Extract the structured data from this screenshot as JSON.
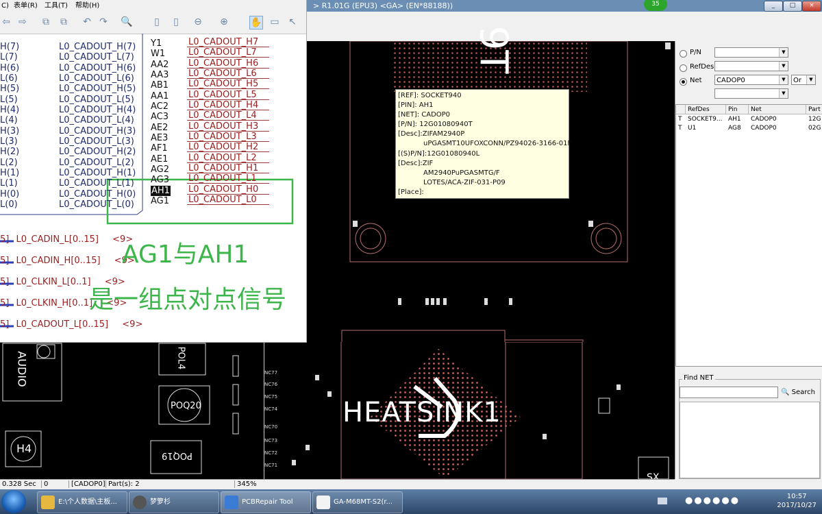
{
  "pcb_window": {
    "title": "> R1.01G (EPU3) <GA> (EN*88188))",
    "badge": "35",
    "controls": [
      "_",
      "□",
      "×"
    ]
  },
  "board_labels": {
    "top_partial": "9T",
    "audio": "AUDIO",
    "h4": "H4",
    "poq20": "POQ20",
    "poq19": "POQ19",
    "pol4": "POL4",
    "heatsink": "HEATSINK1",
    "sx": "SX",
    "nc_labels": [
      "NC77",
      "NC76",
      "NC75",
      "NC74",
      "NC73",
      "NC72",
      "NC71",
      "NC70"
    ]
  },
  "tooltip": {
    "ref": "[REF]:  SOCKET940",
    "pin": "[PIN]:  AH1",
    "net": "[NET]:  CADOP0",
    "pn": "[P/N]:  12G01080940T",
    "desc1": "[Desc]:ZIFAM2940P",
    "desc1b": "uPGASMT10UFOXCONN/PZ94026-3166-01F",
    "spn": "[(S)P/N]:12G01080940L",
    "desc2": "[Desc]:ZIF",
    "desc2b": "AM2940PuPGASMTG/F",
    "desc2c": "LOTES/ACA-ZIF-031-P09",
    "place": "[Place]:"
  },
  "search_panel": {
    "pn_label": "P/N",
    "refdes_label": "RefDes",
    "net_label": "Net",
    "net_value": "CADOP0",
    "logic_value": "Or",
    "selected": "Net"
  },
  "results": {
    "columns": [
      "RefDes",
      "Pin",
      "Net",
      "Part"
    ],
    "rows": [
      {
        "flag": "T",
        "refdes": "SOCKET9...",
        "pin": "AH1",
        "net": "CADOP0",
        "part": "12G"
      },
      {
        "flag": "T",
        "refdes": "U1",
        "pin": "AG8",
        "net": "CADOP0",
        "part": "02G"
      }
    ]
  },
  "find_net": {
    "title": "Find NET",
    "search_label": "Search",
    "input_value": ""
  },
  "statusbar": {
    "time": "0.328 Sec",
    "count": "0",
    "net": "[CADOP0]",
    "parts": "Part(s):  2",
    "zoom": "345%"
  },
  "schematic": {
    "menu": [
      "C)",
      "表单(R)",
      "工具(T)",
      "帮助(H)"
    ],
    "left_signals": [
      {
        "pre": "H(7)",
        "name": "L0_CADOUT_H(7)"
      },
      {
        "pre": "L(7)",
        "name": "L0_CADOUT_L(7)"
      },
      {
        "pre": "H(6)",
        "name": "L0_CADOUT_H(6)"
      },
      {
        "pre": "L(6)",
        "name": "L0_CADOUT_L(6)"
      },
      {
        "pre": "H(5)",
        "name": "L0_CADOUT_H(5)"
      },
      {
        "pre": "L(5)",
        "name": "L0_CADOUT_L(5)"
      },
      {
        "pre": "H(4)",
        "name": "L0_CADOUT_H(4)"
      },
      {
        "pre": "L(4)",
        "name": "L0_CADOUT_L(4)"
      },
      {
        "pre": "H(3)",
        "name": "L0_CADOUT_H(3)"
      },
      {
        "pre": "L(3)",
        "name": "L0_CADOUT_L(3)"
      },
      {
        "pre": "H(2)",
        "name": "L0_CADOUT_H(2)"
      },
      {
        "pre": "L(2)",
        "name": "L0_CADOUT_L(2)"
      },
      {
        "pre": "H(1)",
        "name": "L0_CADOUT_H(1)"
      },
      {
        "pre": "L(1)",
        "name": "L0_CADOUT_L(1)"
      },
      {
        "pre": "H(0)",
        "name": "L0_CADOUT_H(0)"
      },
      {
        "pre": "L(0)",
        "name": "L0_CADOUT_L(0)"
      }
    ],
    "pins": [
      {
        "pin": "Y1",
        "net": "L0_CADOUT_H7"
      },
      {
        "pin": "W1",
        "net": "L0_CADOUT_L7"
      },
      {
        "pin": "AA2",
        "net": "L0_CADOUT_H6"
      },
      {
        "pin": "AA3",
        "net": "L0_CADOUT_L6"
      },
      {
        "pin": "AB1",
        "net": "L0_CADOUT_H5"
      },
      {
        "pin": "AA1",
        "net": "L0_CADOUT_L5"
      },
      {
        "pin": "AC2",
        "net": "L0_CADOUT_H4"
      },
      {
        "pin": "AC3",
        "net": "L0_CADOUT_L4"
      },
      {
        "pin": "AE2",
        "net": "L0_CADOUT_H3"
      },
      {
        "pin": "AE3",
        "net": "L0_CADOUT_L3"
      },
      {
        "pin": "AF1",
        "net": "L0_CADOUT_H2"
      },
      {
        "pin": "AE1",
        "net": "L0_CADOUT_L2"
      },
      {
        "pin": "AG2",
        "net": "L0_CADOUT_H1"
      },
      {
        "pin": "AG3",
        "net": "L0_CADOUT_L1"
      },
      {
        "pin": "AH1",
        "net": "L0_CADOUT_H0"
      },
      {
        "pin": "AG1",
        "net": "L0_CADOUT_L0"
      }
    ],
    "buses": [
      {
        "pre": "5]",
        "name": "L0_CADIN_L[0..15]",
        "page": "<9>"
      },
      {
        "pre": "5]",
        "name": "L0_CADIN_H[0..15]",
        "page": "<9>"
      },
      {
        "pre": "5]",
        "name": "L0_CLKIN_L[0..1]",
        "page": "<9>"
      },
      {
        "pre": "5]",
        "name": "L0_CLKIN_H[0..1]",
        "page": "<9>"
      },
      {
        "pre": "5]",
        "name": "L0_CADOUT_L[0..15]",
        "page": "<9>"
      }
    ],
    "annotation_line1": "AG1与AH1",
    "annotation_line2": "是一组点对点信号"
  },
  "taskbar": {
    "items": [
      {
        "label": "E:\\个人数据\\主板..."
      },
      {
        "label": "梦箩杉"
      },
      {
        "label": "PCBRepair Tool"
      },
      {
        "label": "GA-M68MT-S2(r..."
      }
    ],
    "time": "10:57",
    "date": "2017/10/27"
  }
}
